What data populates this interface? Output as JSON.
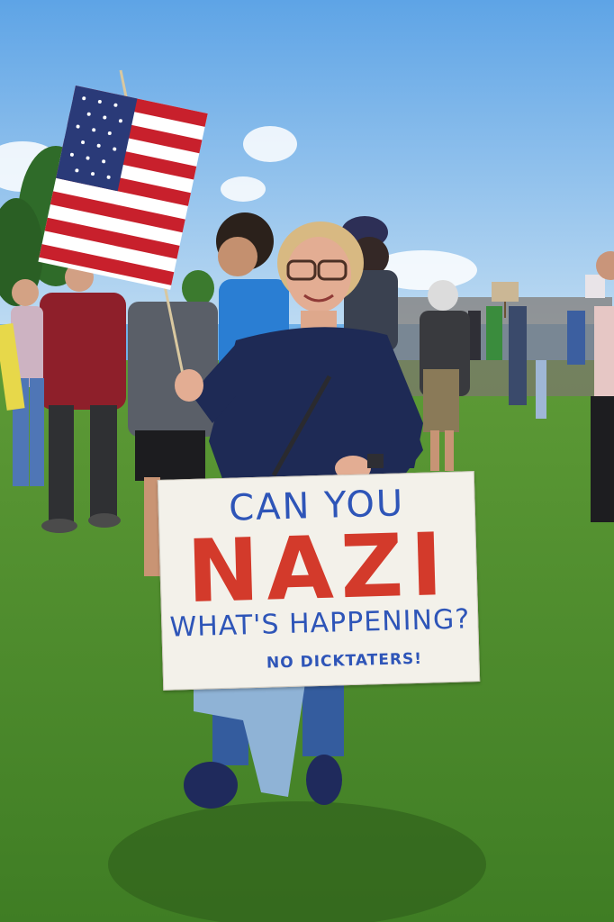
{
  "photo": {
    "subject": "woman",
    "objects": [
      "us-flag",
      "protest-sign",
      "crowd",
      "grass",
      "sky",
      "trees"
    ]
  },
  "sign": {
    "line1": "CAN YOU",
    "line2": "NAZI",
    "line3": "WHAT'S HAPPENING?",
    "line4": "NO DICKTATERS!"
  },
  "colors": {
    "sky": "#6fb0e8",
    "grass": "#4e8f2f",
    "sign_blue": "#2e55b8",
    "sign_red": "#d33a2b",
    "shirt": "#1e2a55"
  }
}
